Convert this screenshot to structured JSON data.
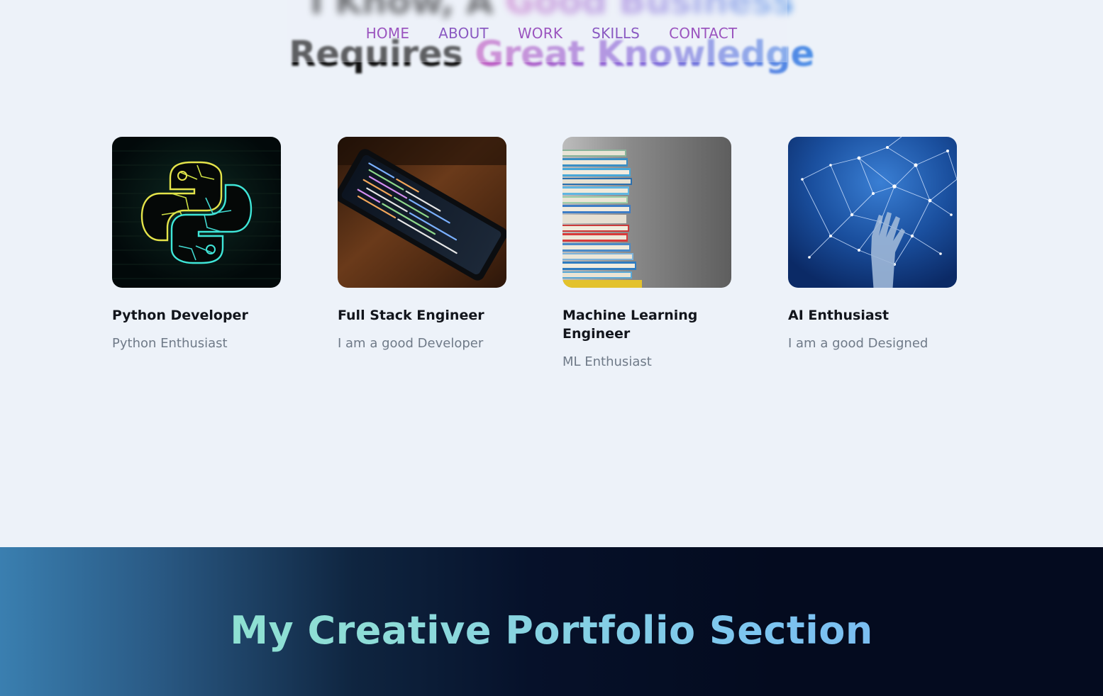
{
  "hero": {
    "line1_plain": "I Know, A ",
    "line1_gradient": "Good Business",
    "line2_plain": "Requires ",
    "line2_gradient": "Great Knowledge"
  },
  "nav": {
    "items": [
      "HOME",
      "ABOUT",
      "WORK",
      "SKILLS",
      "CONTACT"
    ]
  },
  "cards": [
    {
      "title": "Python Developer",
      "subtitle": "Python Enthusiast",
      "image": "python-logo-image"
    },
    {
      "title": "Full Stack Engineer",
      "subtitle": "I am a good Developer",
      "image": "smartphone-code-image"
    },
    {
      "title": "Machine Learning Engineer",
      "subtitle": "ML Enthusiast",
      "image": "book-stack-image"
    },
    {
      "title": "AI Enthusiast",
      "subtitle": "I am a good Designed",
      "image": "robot-network-image"
    }
  ],
  "portfolio": {
    "heading": "My Creative Portfolio Section"
  },
  "colors": {
    "background": "#edf2f9",
    "nav_link": "#9b55bf",
    "band_dark": "#040b1f",
    "band_light": "#3a7fb0"
  }
}
